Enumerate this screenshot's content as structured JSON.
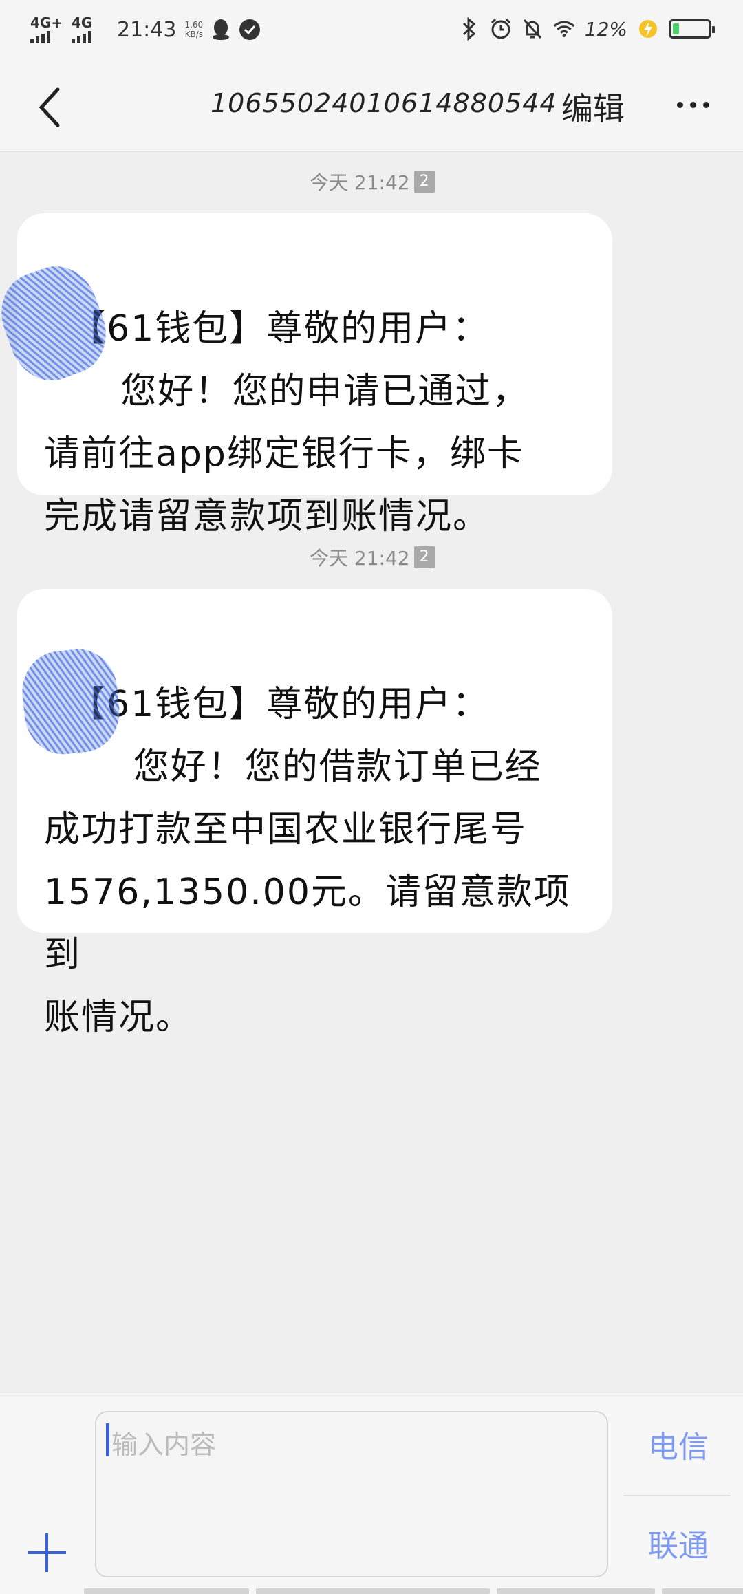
{
  "status_bar": {
    "network1": "4G+",
    "network2": "4G",
    "time": "21:43",
    "speed_value": "1.60",
    "speed_unit": "KB/s",
    "battery_percent": "12%",
    "battery_level": 0.12,
    "icons": [
      "qq-icon",
      "check-circle-icon",
      "bluetooth-icon",
      "alarm-icon",
      "mute-icon",
      "wifi-icon",
      "charging-icon",
      "battery-icon"
    ]
  },
  "header": {
    "back_icon": "chevron-left-icon",
    "title": "10655024010614880544",
    "edit_label": "编辑",
    "more_icon": "more-dots-icon"
  },
  "messages": [
    {
      "time": "今天 21:42",
      "sim": "2",
      "text": "【61钱包】尊敬的用户：\n      您好！您的申请已通过，\n请前往app绑定银行卡，绑卡\n完成请留意款项到账情况。"
    },
    {
      "time": "今天 21:42",
      "sim": "2",
      "text": "【61钱包】尊敬的用户：\n       您好！您的借款订单已经\n成功打款至中国农业银行尾号\n1576,1350.00元。请留意款项到\n账情况。"
    }
  ],
  "composer": {
    "plus_icon": "plus-icon",
    "placeholder": "输入内容",
    "send_carrier1": "电信",
    "send_carrier2": "联通"
  },
  "colors": {
    "accent": "#3a62d8",
    "send_text": "#7f9cf0",
    "background": "#efefef",
    "bubble": "#ffffff"
  }
}
